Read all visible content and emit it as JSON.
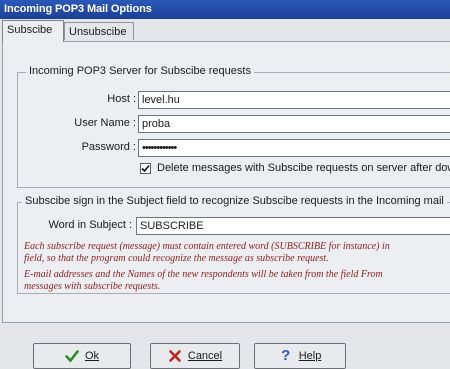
{
  "window": {
    "title": "Incoming POP3 Mail Options"
  },
  "tabs": [
    {
      "label": "Subscibe",
      "active": true
    },
    {
      "label": "Unsubscibe",
      "active": false
    }
  ],
  "server_group": {
    "legend": "Incoming POP3 Server for Subscibe requests",
    "host_label": "Host :",
    "host_value": "level.hu",
    "username_label": "User Name :",
    "username_value": "proba",
    "password_label": "Password :",
    "password_value": "••••••••••••",
    "delete_checkbox_label": "Delete messages with Subscibe requests on server after downlo",
    "delete_checked": true
  },
  "subject_group": {
    "legend": "Subscibe sign in the Subject field to recognize Subscibe requests in the Incoming mail",
    "word_label": "Word in Subject :",
    "word_value": "SUBSCRIBE",
    "note1_line1": "Each subscribe request (message) must contain entered word (SUBSCRIBE for instance) in",
    "note1_line2": "field, so that the program could recognize the message as subscribe request.",
    "note2_line1": "E-mail addresses and the Names of the new respondents will be taken from the field From",
    "note2_line2": "messages with subscribe requests."
  },
  "buttons": {
    "ok_label": "Ok",
    "cancel_label": "Cancel",
    "help_label": "Help"
  },
  "colors": {
    "titlebar": "#1c3f95",
    "ok_icon": "#2f8a2a",
    "cancel_icon": "#c0231f",
    "help_icon": "#2b57c8"
  }
}
